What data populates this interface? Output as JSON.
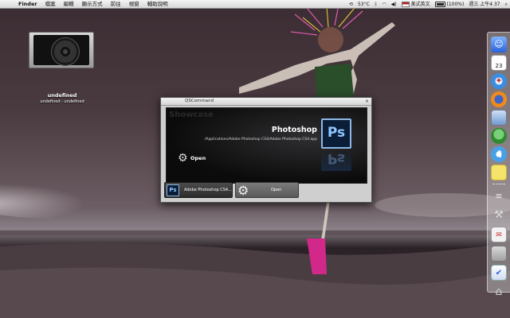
{
  "menubar": {
    "apple_glyph": "",
    "app_name": "Finder",
    "menus": [
      "檔案",
      "編輯",
      "顯示方式",
      "前往",
      "視窗",
      "輔助說明"
    ],
    "status": {
      "temperature": "53°C",
      "input_method": "美式英文",
      "battery": "(100%)",
      "clock": "週三 上午4 37"
    }
  },
  "desktop": {
    "disk": {
      "label": "undefined",
      "sublabel": "undefined - undefined"
    }
  },
  "qs_window": {
    "title": "QSCommand",
    "close_glyph": "×",
    "showcase_label": "Showcase",
    "item_name": "Photoshop",
    "item_path": "/Applications/Adobe Photoshop CS4/Adobe Photoshop CS4.app",
    "icon_text": "Ps",
    "action_name": "Open",
    "object_pane_label": "Adobe Photoshop CS4…",
    "action_pane_label": "Open"
  },
  "dock": {
    "items": [
      {
        "icon": "finder-icon"
      },
      {
        "icon": "calendar-icon",
        "text": "23"
      },
      {
        "icon": "safari-icon"
      },
      {
        "icon": "firefox-icon"
      },
      {
        "icon": "preview-icon"
      },
      {
        "icon": "adium-icon"
      },
      {
        "icon": "itunes-icon"
      },
      {
        "icon": "stickies-icon"
      },
      {
        "icon": "applications-icon"
      },
      {
        "icon": "utilities-icon"
      },
      {
        "icon": "mail-icon"
      },
      {
        "icon": "photos-icon"
      },
      {
        "icon": "pages-icon"
      },
      {
        "icon": "documents-icon"
      },
      {
        "icon": "trash-icon"
      }
    ]
  }
}
